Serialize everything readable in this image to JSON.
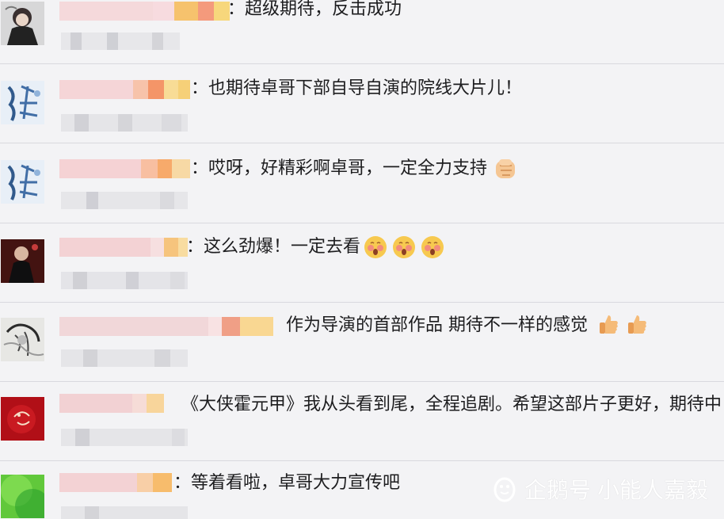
{
  "comments": [
    {
      "text": "：超级期待，反击成功"
    },
    {
      "text": "：也期待卓哥下部自导自演的院线大片儿！"
    },
    {
      "text": "：哎呀，好精彩啊卓哥，一定全力支持"
    },
    {
      "text": "：这么劲爆！一定去看"
    },
    {
      "text": "作为导演的首部作品 期待不一样的感觉"
    },
    {
      "text": "《大侠霍元甲》我从头看到尾，全程追剧。希望这部片子更好，期待中"
    },
    {
      "text": "：等着看啦，卓哥大力宣传吧"
    }
  ],
  "watermark": {
    "brand": "企鹅号",
    "account": "小能人嘉毅"
  },
  "colors": {
    "background": "#f3f3f5",
    "divider": "#d9d9de",
    "text": "#1d1d1f",
    "blur_pink": "#f4c9cc",
    "blur_orange": "#f6b267",
    "blur_gray": "#d8d8dc"
  }
}
